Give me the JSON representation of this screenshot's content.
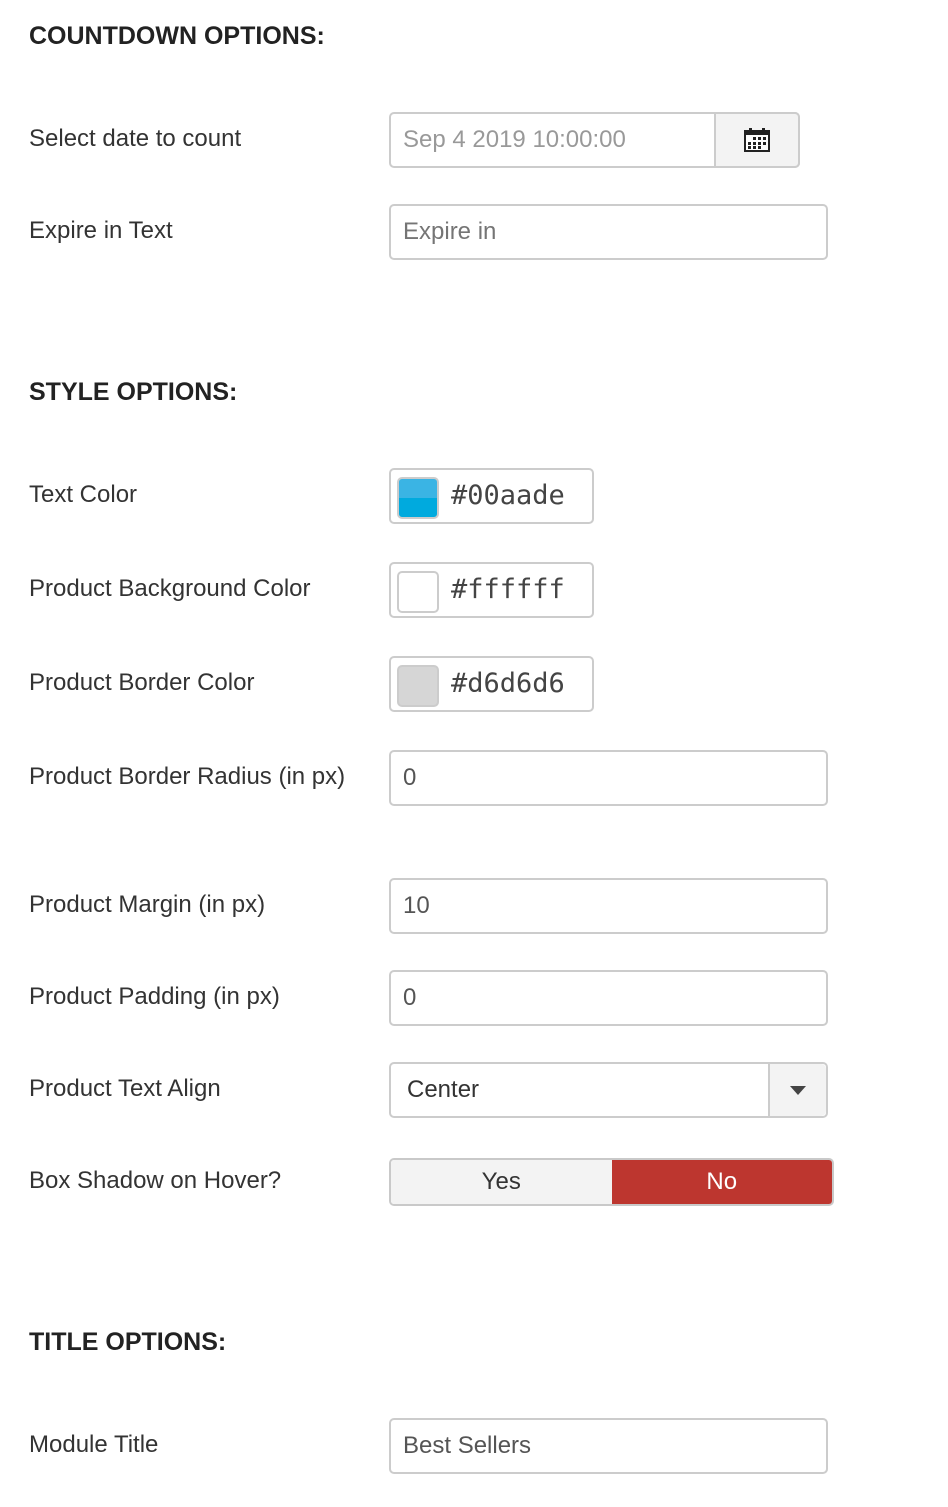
{
  "countdown": {
    "heading": "COUNTDOWN OPTIONS:",
    "date_label": "Select date to count",
    "date_value": "Sep 4 2019 10:00:00",
    "date_icon": "calendar-icon",
    "expire_label": "Expire in Text",
    "expire_placeholder": "Expire in"
  },
  "style": {
    "heading": "STYLE OPTIONS:",
    "text_color_label": "Text Color",
    "text_color": "#00aade",
    "bg_color_label": "Product Background Color",
    "bg_color": "#ffffff",
    "border_color_label": "Product Border Color",
    "border_color": "#d6d6d6",
    "radius_label": "Product Border Radius (in px)",
    "radius_value": "0",
    "margin_label": "Product Margin (in px)",
    "margin_value": "10",
    "padding_label": "Product Padding (in px)",
    "padding_value": "0",
    "align_label": "Product Text Align",
    "align_value": "Center",
    "shadow_label": "Box Shadow on Hover?",
    "shadow_yes": "Yes",
    "shadow_no": "No",
    "shadow_selected": "No",
    "active_color": "#bd362f"
  },
  "title": {
    "heading": "TITLE OPTIONS:",
    "module_title_label": "Module Title",
    "module_title_value": "Best Sellers"
  }
}
